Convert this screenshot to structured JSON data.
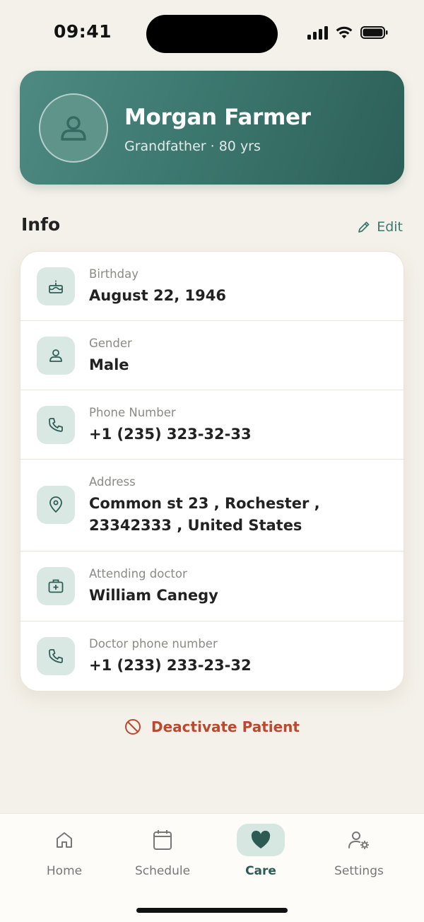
{
  "status": {
    "time": "09:41"
  },
  "profile": {
    "name": "Morgan Farmer",
    "subtitle": "Grandfather · 80 yrs"
  },
  "info": {
    "title": "Info",
    "edit_label": "Edit",
    "rows": [
      {
        "label": "Birthday",
        "value": "August 22, 1946",
        "icon": "cake-icon"
      },
      {
        "label": "Gender",
        "value": "Male",
        "icon": "person-icon"
      },
      {
        "label": "Phone Number",
        "value": "+1 (235) 323-32-33",
        "icon": "phone-icon"
      },
      {
        "label": "Address",
        "value": "Common st 23 , Rochester , 23342333 , United States",
        "icon": "location-pin-icon"
      },
      {
        "label": "Attending doctor",
        "value": "William Canegy",
        "icon": "medical-kit-icon"
      },
      {
        "label": "Doctor phone number",
        "value": "+1 (233) 233-23-32",
        "icon": "phone-icon"
      }
    ]
  },
  "deactivate_label": "Deactivate Patient",
  "tabs": [
    {
      "label": "Home",
      "icon": "home-icon",
      "active": false
    },
    {
      "label": "Schedule",
      "icon": "calendar-icon",
      "active": false
    },
    {
      "label": "Care",
      "icon": "heart-icon",
      "active": true
    },
    {
      "label": "Settings",
      "icon": "user-settings-icon",
      "active": false
    }
  ],
  "colors": {
    "accent": "#3b7a70",
    "header_gradient_start": "#4f8a82",
    "header_gradient_end": "#2c5f57",
    "background": "#f4f1ea",
    "danger": "#b9492f",
    "icon_bg": "#d9e8e3"
  }
}
